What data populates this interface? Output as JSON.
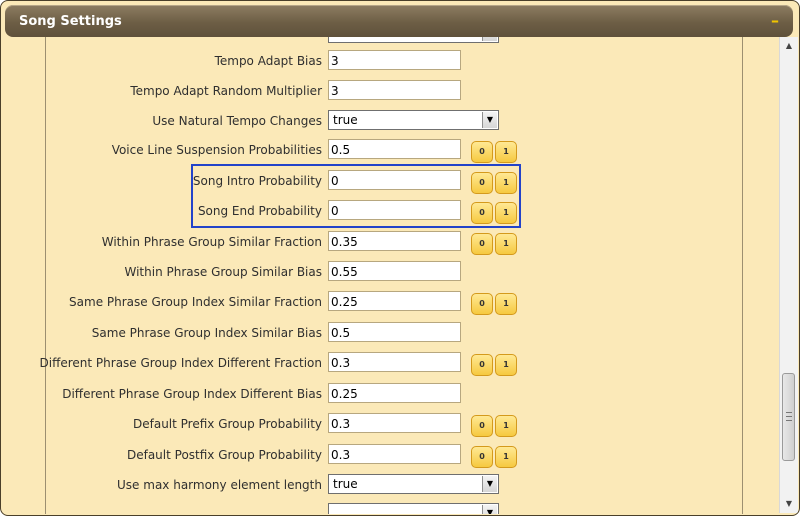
{
  "panel": {
    "title": "Song Settings",
    "collapse_label": "–"
  },
  "rows": [
    {
      "label": "Tempo Adapt Bias",
      "value": "3"
    },
    {
      "label": "Tempo Adapt Random Multiplier",
      "value": "3"
    },
    {
      "label": "Use Natural Tempo Changes",
      "value": "true"
    },
    {
      "label": "Voice Line Suspension Probabilities",
      "value": "0.5",
      "btn0": "0",
      "btn1": "1"
    },
    {
      "label": "Song Intro Probability",
      "value": "0",
      "btn0": "0",
      "btn1": "1"
    },
    {
      "label": "Song End Probability",
      "value": "0",
      "btn0": "0",
      "btn1": "1"
    },
    {
      "label": "Within Phrase Group Similar Fraction",
      "value": "0.35",
      "btn0": "0",
      "btn1": "1"
    },
    {
      "label": "Within Phrase Group Similar Bias",
      "value": "0.55"
    },
    {
      "label": "Same Phrase Group Index Similar Fraction",
      "value": "0.25",
      "btn0": "0",
      "btn1": "1"
    },
    {
      "label": "Same Phrase Group Index Similar Bias",
      "value": "0.5"
    },
    {
      "label": "Different Phrase Group Index Different Fraction",
      "value": "0.3",
      "btn0": "0",
      "btn1": "1"
    },
    {
      "label": "Different Phrase Group Index Different Bias",
      "value": "0.25"
    },
    {
      "label": "Default Prefix Group Probability",
      "value": "0.3",
      "btn0": "0",
      "btn1": "1"
    },
    {
      "label": "Default Postfix Group Probability",
      "value": "0.3",
      "btn0": "0",
      "btn1": "1"
    },
    {
      "label": "Use max harmony element length",
      "value": "true"
    }
  ],
  "scrollbar": {
    "up_icon": "triangle-up-icon",
    "down_icon": "triangle-down-icon"
  },
  "colors": {
    "panel_bg": "#fbe9b8",
    "titlebar": "#6d5e45",
    "highlight_border": "#2343c9",
    "button_fill": "#f6c940"
  }
}
